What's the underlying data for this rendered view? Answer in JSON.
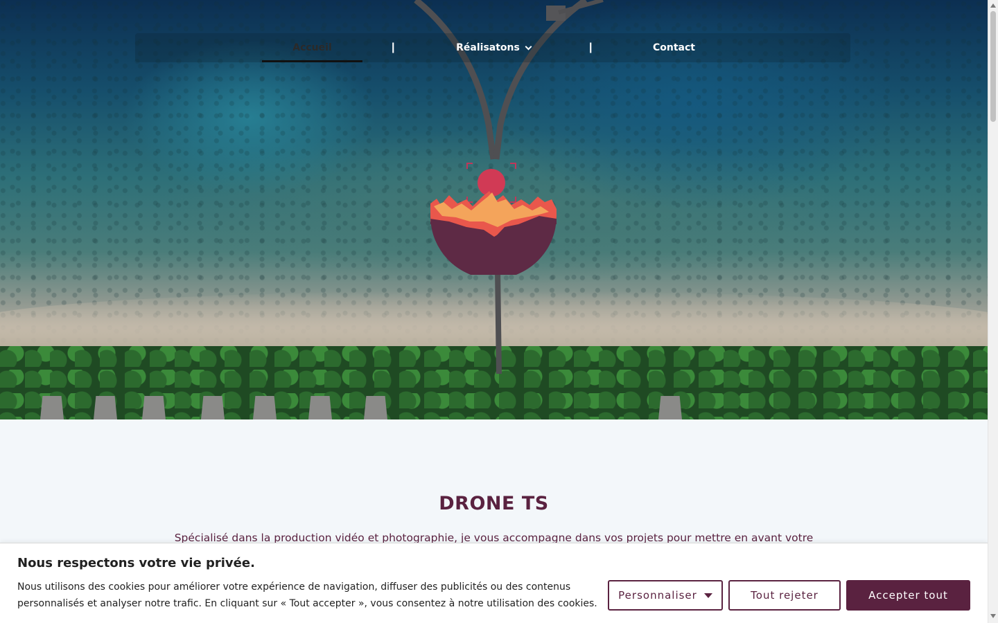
{
  "nav": {
    "items": [
      {
        "label": "Accueil",
        "active": true
      },
      {
        "label": "Réalisatons",
        "has_dropdown": true
      },
      {
        "label": "Contact"
      }
    ],
    "separator": "|"
  },
  "hero": {
    "logo_icon": "mountain-sun-logo",
    "colors": {
      "sun": "#d13a55",
      "peaks_light": "#f4a45b",
      "peaks_mid": "#e9574c",
      "base": "#5e2a45"
    }
  },
  "intro": {
    "title": "DRONE TS",
    "text": "Spécialisé dans la production vidéo et photographie, je vous accompagne dans vos projets pour mettre en avant votre"
  },
  "cookie_banner": {
    "title": "Nous respectons votre vie privée.",
    "text": "Nous utilisons des cookies pour améliorer votre expérience de navigation, diffuser des publicités ou des contenus personnalisés et analyser notre trafic. En cliquant sur « Tout accepter », vous consentez à notre utilisation des cookies.",
    "customize_label": "Personnaliser",
    "reject_label": "Tout rejeter",
    "accept_label": "Accepter tout"
  },
  "colors": {
    "brand": "#5a2240",
    "page_bg": "#f3f7fa"
  }
}
